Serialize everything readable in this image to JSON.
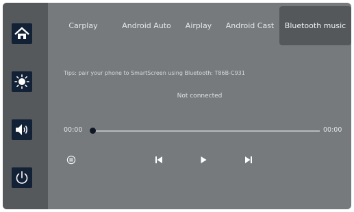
{
  "sidebar": {
    "items": [
      {
        "icon": "home-icon"
      },
      {
        "icon": "brightness-icon"
      },
      {
        "icon": "volume-icon"
      },
      {
        "icon": "power-icon"
      }
    ]
  },
  "tabs": [
    {
      "label": "Carplay"
    },
    {
      "label": "Android Auto"
    },
    {
      "label": "Airplay"
    },
    {
      "label": "Android Cast"
    },
    {
      "label": "Bluetooth music",
      "active": true
    }
  ],
  "tip": "Tips: pair your phone to SmartScreen using Bluetooth: T86B-C931",
  "status": "Not connected",
  "player": {
    "elapsed": "00:00",
    "duration": "00:00",
    "progress": 0,
    "controls": [
      "list-icon",
      "previous-icon",
      "play-icon",
      "next-icon"
    ]
  },
  "colors": {
    "screen_bg": "#767a7d",
    "sidebar_bg": "#55595c",
    "button_bg": "#132137",
    "active_tab_bg": "#54585b"
  }
}
